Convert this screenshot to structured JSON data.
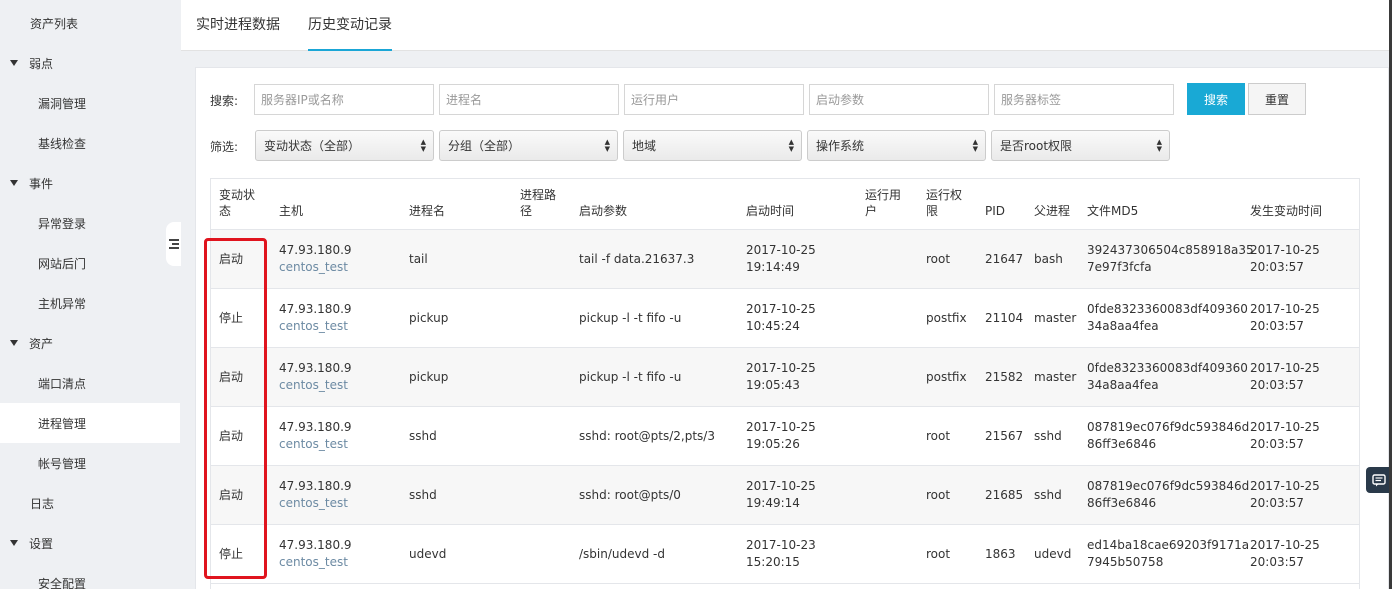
{
  "sidebar": {
    "items": [
      {
        "label": "资产列表",
        "kind": "top"
      },
      {
        "label": "弱点",
        "kind": "section"
      },
      {
        "label": "漏洞管理",
        "kind": "sub"
      },
      {
        "label": "基线检查",
        "kind": "sub"
      },
      {
        "label": "事件",
        "kind": "section"
      },
      {
        "label": "异常登录",
        "kind": "sub"
      },
      {
        "label": "网站后门",
        "kind": "sub"
      },
      {
        "label": "主机异常",
        "kind": "sub"
      },
      {
        "label": "资产",
        "kind": "section"
      },
      {
        "label": "端口清点",
        "kind": "sub"
      },
      {
        "label": "进程管理",
        "kind": "sub",
        "active": true
      },
      {
        "label": "帐号管理",
        "kind": "sub"
      },
      {
        "label": "日志",
        "kind": "top"
      },
      {
        "label": "设置",
        "kind": "section"
      },
      {
        "label": "安全配置",
        "kind": "sub"
      }
    ]
  },
  "tabs": [
    {
      "label": "实时进程数据",
      "active": false
    },
    {
      "label": "历史变动记录",
      "active": true
    }
  ],
  "search": {
    "label": "搜索:",
    "inputs": [
      {
        "placeholder": "服务器IP或名称",
        "value": ""
      },
      {
        "placeholder": "进程名",
        "value": ""
      },
      {
        "placeholder": "运行用户",
        "value": ""
      },
      {
        "placeholder": "启动参数",
        "value": ""
      },
      {
        "placeholder": "服务器标签",
        "value": ""
      }
    ],
    "search_button": "搜索",
    "reset_button": "重置"
  },
  "filter": {
    "label": "筛选:",
    "selects": [
      "变动状态（全部）",
      "分组（全部）",
      "地域",
      "操作系统",
      "是否root权限"
    ]
  },
  "table": {
    "headers": {
      "status": [
        "变动状",
        "态"
      ],
      "host": [
        "主机"
      ],
      "proc": [
        "进程名"
      ],
      "path": [
        "进程路",
        "径"
      ],
      "args": [
        "启动参数"
      ],
      "start": [
        "启动时间"
      ],
      "user": [
        "运行用",
        "户"
      ],
      "perm": [
        "运行权",
        "限"
      ],
      "pid": [
        "PID"
      ],
      "parent": [
        "父进程"
      ],
      "md5": [
        "文件MD5"
      ],
      "changed": [
        "发生变动时间"
      ]
    },
    "rows": [
      {
        "status": "启动",
        "ip": "47.93.180.9",
        "hostname": "centos_test",
        "proc": "tail",
        "path": "",
        "args": "tail -f data.21637.3",
        "start_date": "2017-10-25",
        "start_time": "19:14:49",
        "user": "",
        "perm": "root",
        "pid": "21647",
        "parent": "bash",
        "md5_a": "392437306504c858918a35",
        "md5_b": "7e97f3fcfa",
        "chg_date": "2017-10-25",
        "chg_time": "20:03:57"
      },
      {
        "status": "停止",
        "ip": "47.93.180.9",
        "hostname": "centos_test",
        "proc": "pickup",
        "path": "",
        "args": "pickup -l -t fifo -u",
        "start_date": "2017-10-25",
        "start_time": "10:45:24",
        "user": "",
        "perm": "postfix",
        "pid": "21104",
        "parent": "master",
        "md5_a": "0fde8323360083df409360",
        "md5_b": "34a8aa4fea",
        "chg_date": "2017-10-25",
        "chg_time": "20:03:57"
      },
      {
        "status": "启动",
        "ip": "47.93.180.9",
        "hostname": "centos_test",
        "proc": "pickup",
        "path": "",
        "args": "pickup -l -t fifo -u",
        "start_date": "2017-10-25",
        "start_time": "19:05:43",
        "user": "",
        "perm": "postfix",
        "pid": "21582",
        "parent": "master",
        "md5_a": "0fde8323360083df409360",
        "md5_b": "34a8aa4fea",
        "chg_date": "2017-10-25",
        "chg_time": "20:03:57"
      },
      {
        "status": "启动",
        "ip": "47.93.180.9",
        "hostname": "centos_test",
        "proc": "sshd",
        "path": "",
        "args": "sshd: root@pts/2,pts/3",
        "start_date": "2017-10-25",
        "start_time": "19:05:26",
        "user": "",
        "perm": "root",
        "pid": "21567",
        "parent": "sshd",
        "md5_a": "087819ec076f9dc593846d",
        "md5_b": "86ff3e6846",
        "chg_date": "2017-10-25",
        "chg_time": "20:03:57"
      },
      {
        "status": "启动",
        "ip": "47.93.180.9",
        "hostname": "centos_test",
        "proc": "sshd",
        "path": "",
        "args": "sshd: root@pts/0",
        "start_date": "2017-10-25",
        "start_time": "19:49:14",
        "user": "",
        "perm": "root",
        "pid": "21685",
        "parent": "sshd",
        "md5_a": "087819ec076f9dc593846d",
        "md5_b": "86ff3e6846",
        "chg_date": "2017-10-25",
        "chg_time": "20:03:57"
      },
      {
        "status": "停止",
        "ip": "47.93.180.9",
        "hostname": "centos_test",
        "proc": "udevd",
        "path": "",
        "args": "/sbin/udevd -d",
        "start_date": "2017-10-23",
        "start_time": "15:20:15",
        "user": "",
        "perm": "root",
        "pid": "1863",
        "parent": "udevd",
        "md5_a": "ed14ba18cae69203f9171a",
        "md5_b": "7945b50758",
        "chg_date": "2017-10-25",
        "chg_time": "20:03:57"
      }
    ]
  },
  "colors": {
    "accent": "#19a9d5",
    "highlight": "#e0141e",
    "host_link": "#6c8aa3"
  },
  "icons": {
    "collapse": "collapse-sidebar-icon",
    "chat": "chat-icon"
  }
}
